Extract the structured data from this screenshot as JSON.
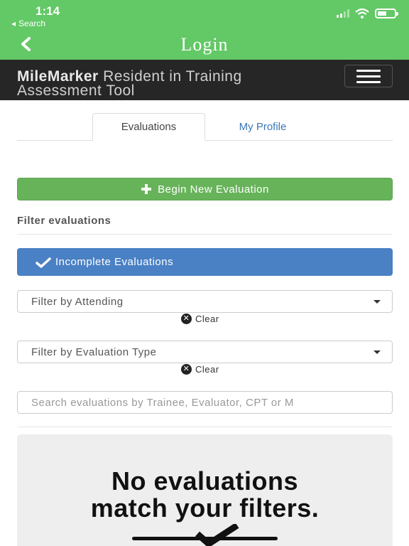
{
  "status_bar": {
    "time": "1:14",
    "back_app": "Search"
  },
  "nav": {
    "title": "Login"
  },
  "brand": {
    "name": "MileMarker",
    "tagline": "Resident in Training Assessment Tool"
  },
  "tabs": [
    {
      "label": "Evaluations",
      "active": true
    },
    {
      "label": "My Profile",
      "active": false
    }
  ],
  "actions": {
    "new_evaluation": "Begin New Evaluation"
  },
  "filters": {
    "section_label": "Filter evaluations",
    "incomplete_label": "Incomplete Evaluations",
    "attending_placeholder": "Filter by Attending",
    "type_placeholder": "Filter by Evaluation Type",
    "clear_label": "Clear",
    "search_placeholder": "Search evaluations by Trainee, Evaluator, CPT or M"
  },
  "empty_state": {
    "line1": "No evaluations",
    "line2": "match your filters."
  },
  "colors": {
    "nav_green": "#63c866",
    "brand_dark": "#262626",
    "action_green": "#67b35a",
    "action_blue": "#4a80c4",
    "link_blue": "#3a78b5"
  }
}
